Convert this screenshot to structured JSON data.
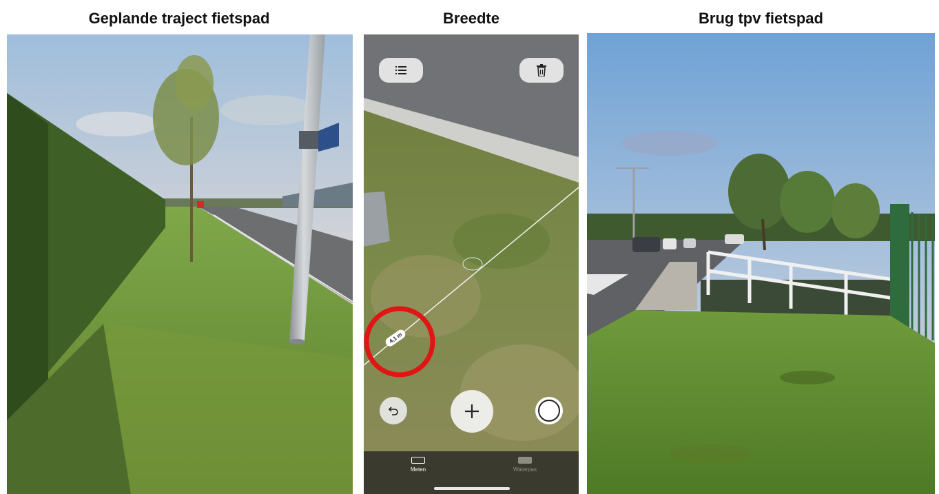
{
  "captions": {
    "left": "Geplande traject fietspad",
    "middle": "Breedte",
    "right": "Brug tpv fietspad"
  },
  "phone": {
    "measurement": "4,1 m",
    "tabs": [
      {
        "label": "Meten",
        "icon": "ruler-icon",
        "active": true
      },
      {
        "label": "Waterpas",
        "icon": "level-icon",
        "active": false
      }
    ],
    "icons": {
      "list": "list-icon",
      "trash": "trash-icon",
      "undo": "undo-icon",
      "add": "plus-icon",
      "shutter": "shutter-icon"
    },
    "highlight_color": "#e01515"
  },
  "colors": {
    "sky": "#a9c2dc",
    "grass": "#6f9a3c",
    "asphalt": "#6d6e70",
    "fence": "#2e6b3d"
  }
}
